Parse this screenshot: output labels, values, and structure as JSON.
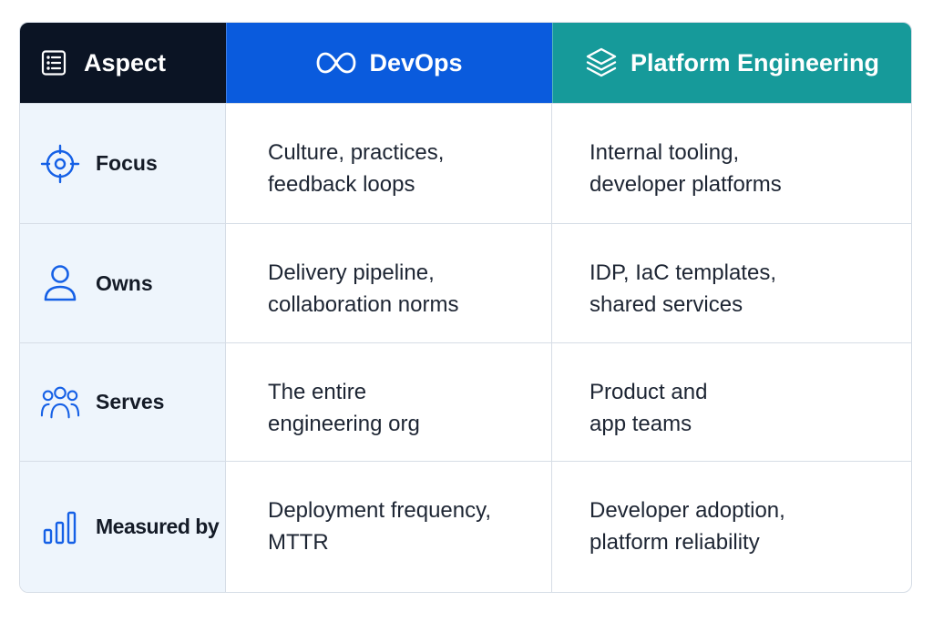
{
  "header": {
    "aspect": {
      "label": "Aspect",
      "icon": "list-icon"
    },
    "devops": {
      "label": "DevOps",
      "icon": "infinity-icon"
    },
    "platform": {
      "label": "Platform Engineering",
      "icon": "layers-icon"
    }
  },
  "rows": [
    {
      "label": "Focus",
      "icon": "target-icon",
      "devops": [
        "Culture, practices,",
        "feedback loops"
      ],
      "platform": [
        "Internal tooling,",
        "developer platforms"
      ]
    },
    {
      "label": "Owns",
      "icon": "user-icon",
      "devops": [
        "Delivery pipeline,",
        "collaboration norms"
      ],
      "platform": [
        "IDP, IaC templates,",
        "shared services"
      ]
    },
    {
      "label": "Serves",
      "icon": "users-icon",
      "devops": [
        "The entire",
        "engineering org"
      ],
      "platform": [
        "Product and",
        "app teams"
      ]
    },
    {
      "label": "Measured by",
      "icon": "bar-chart-icon",
      "devops": [
        "Deployment frequency,",
        "MTTR"
      ],
      "platform": [
        "Developer adoption,",
        "platform reliability"
      ]
    }
  ],
  "colors": {
    "aspect_header": "#0b1424",
    "devops_header": "#0a5bdd",
    "platform_header": "#169a9a",
    "label_column": "#eef5fc",
    "icon_blue": "#1560e6"
  }
}
